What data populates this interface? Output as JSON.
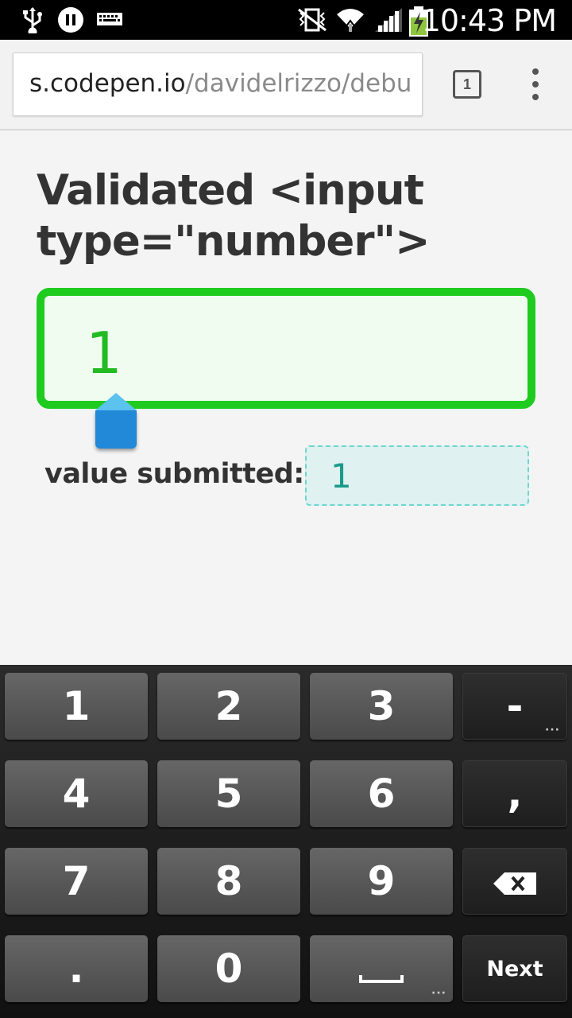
{
  "status_bar": {
    "time": "10:43 PM",
    "icons": [
      "usb-icon",
      "media-pause-icon",
      "keyboard-icon",
      "vibrate-silent-icon",
      "wifi-icon",
      "signal-icon",
      "battery-charging-icon"
    ]
  },
  "browser": {
    "url_domain": "s.codepen.io",
    "url_path": "/davidelrizzo/debu",
    "tab_count": "1"
  },
  "page": {
    "title": "Validated <input type=\"number\">",
    "input_value": "1",
    "submitted_label": "value submitted:",
    "submitted_value": "1"
  },
  "colors": {
    "input_border": "#1ecb1e",
    "input_text": "#22bb22",
    "submitted_bg": "#dff1f0",
    "submitted_text": "#1a9a8a",
    "cursor_handle": "#2288d8"
  },
  "keyboard": {
    "row1": [
      "1",
      "2",
      "3",
      "-"
    ],
    "row2": [
      "4",
      "5",
      "6",
      ","
    ],
    "row3": [
      "7",
      "8",
      "9"
    ],
    "row4": [
      ".",
      "0"
    ],
    "next_label": "Next",
    "backspace_icon": "backspace-icon",
    "space_icon": "space-icon"
  }
}
